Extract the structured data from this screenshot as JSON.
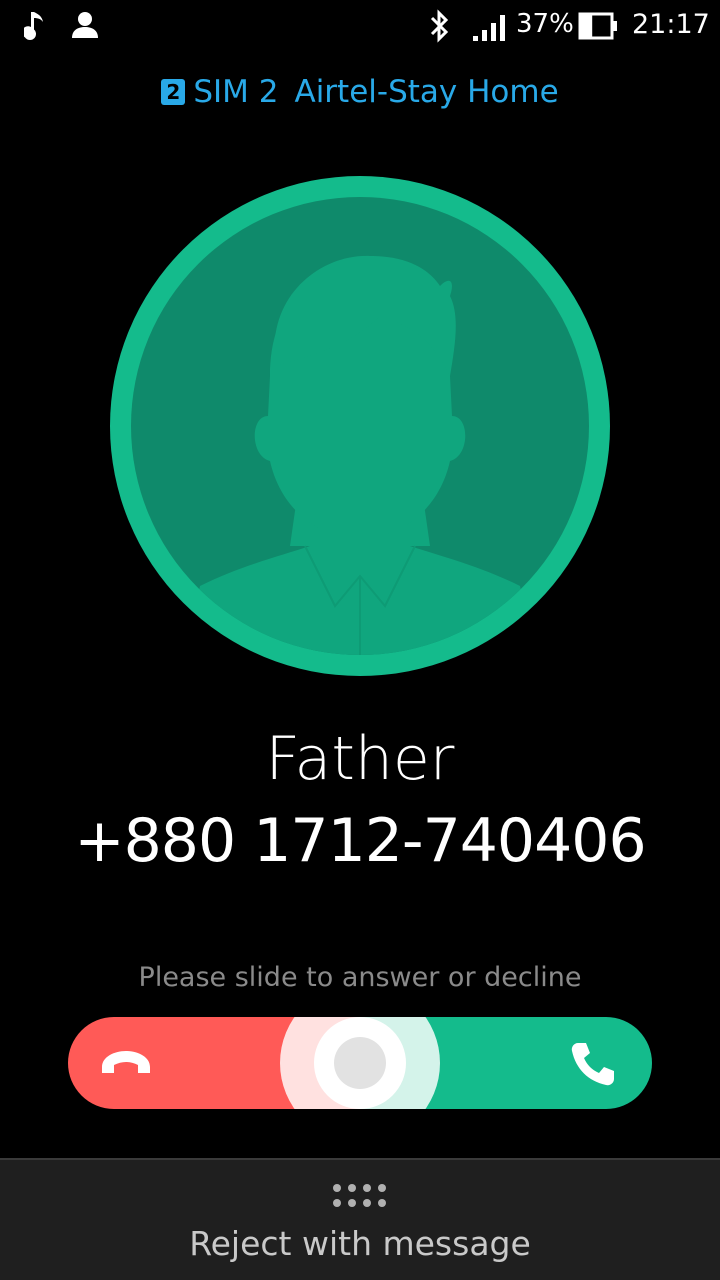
{
  "status_bar": {
    "icons": [
      "music-note-icon",
      "contact-icon",
      "bluetooth-icon",
      "signal-icon",
      "battery-icon"
    ],
    "battery_percent": "37%",
    "battery_level": 0.37,
    "time": "21:17"
  },
  "sim": {
    "badge": "2",
    "label": "SIM 2",
    "carrier": "Airtel-Stay Home",
    "color": "#29a9e8"
  },
  "caller": {
    "name": "Father",
    "number": "+880 1712-740406",
    "avatar_icon": "default-person-avatar-icon",
    "avatar_color": "#14bb8c"
  },
  "slider": {
    "hint": "Please slide to answer or decline",
    "decline_icon": "hang-up-phone-icon",
    "answer_icon": "phone-icon",
    "decline_color": "#ff5a57",
    "answer_color": "#14bb8c"
  },
  "bottom": {
    "handle_icon": "drag-dots-icon",
    "reject_label": "Reject with message"
  }
}
